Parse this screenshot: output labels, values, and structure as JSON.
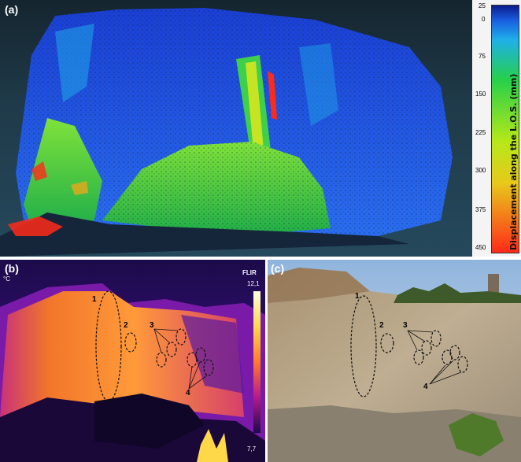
{
  "panels": {
    "a": {
      "label": "(a)"
    },
    "b": {
      "label": "(b)",
      "unit_symbol": "°C",
      "brand": "FLIR",
      "top_temp": "12,1",
      "bottom_temp": "7,7"
    },
    "c": {
      "label": "(c)"
    }
  },
  "colorbar": {
    "title": "Displacement along the L.O.S. (mm)",
    "ticks": [
      "25",
      "0",
      "75",
      "150",
      "225",
      "300",
      "375",
      "450"
    ],
    "colors": [
      "#0a1a8c",
      "#1a5ee0",
      "#1fb0e8",
      "#26d04a",
      "#e8e81a",
      "#ff2a1a"
    ]
  },
  "annotations_b": [
    "1",
    "2",
    "3",
    "4"
  ],
  "annotations_c": [
    "1",
    "2",
    "3",
    "4"
  ]
}
